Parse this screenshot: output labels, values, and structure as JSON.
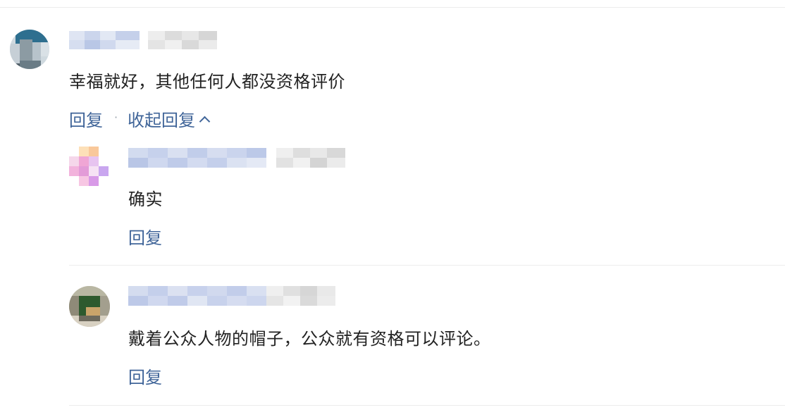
{
  "comment": {
    "text": "幸福就好，其他任何人都没资格评价",
    "reply_label": "回复",
    "separator": "·",
    "collapse_label": "收起回复",
    "collapse_icon": "chevron-up-icon"
  },
  "replies": [
    {
      "text": "确实",
      "reply_label": "回复"
    },
    {
      "text": "戴着公众人物的帽子，公众就有资格可以评论。",
      "reply_label": "回复"
    }
  ],
  "colors": {
    "link": "#406599",
    "text": "#222222",
    "divider": "#ececec"
  }
}
